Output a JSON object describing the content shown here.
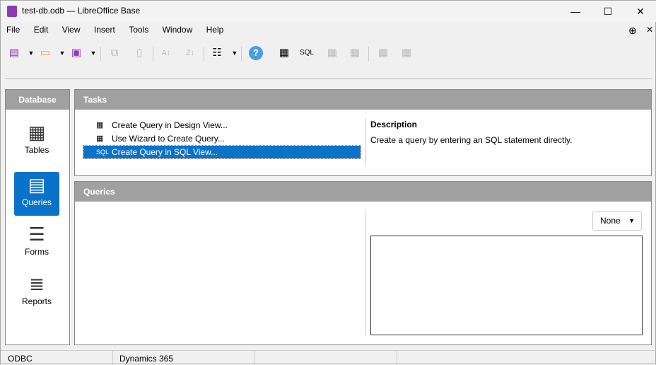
{
  "window": {
    "title": "test-db.odb — LibreOffice Base",
    "minimize": "—",
    "maximize": "☐",
    "close": "✕"
  },
  "menu": [
    "File",
    "Edit",
    "View",
    "Insert",
    "Tools",
    "Window",
    "Help"
  ],
  "sidebar": {
    "header": "Database",
    "items": [
      {
        "label": "Tables",
        "icon": "▦"
      },
      {
        "label": "Queries",
        "icon": "▤"
      },
      {
        "label": "Forms",
        "icon": "☰"
      },
      {
        "label": "Reports",
        "icon": "≣"
      }
    ]
  },
  "tasks": {
    "header": "Tasks",
    "items": [
      "Create Query in Design View...",
      "Use Wizard to Create Query...",
      "Create Query in SQL View..."
    ],
    "description_title": "Description",
    "description": "Create a query by entering an SQL statement directly."
  },
  "queries": {
    "header": "Queries",
    "preview_select": "None"
  },
  "status": [
    "ODBC",
    "Dynamics 365"
  ],
  "toolbar": {
    "sql_label": "SQL",
    "help": "?"
  }
}
